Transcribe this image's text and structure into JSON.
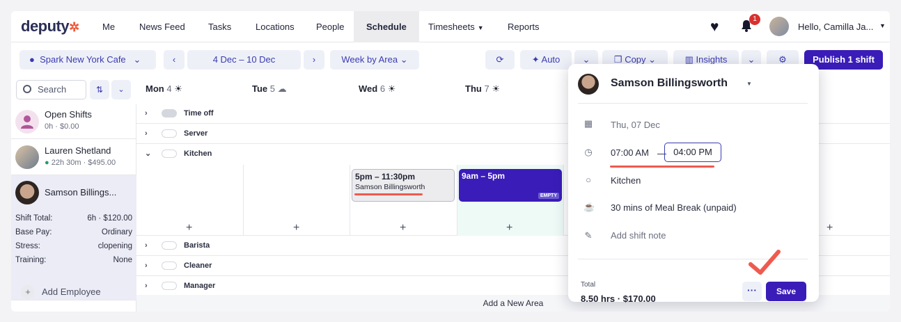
{
  "nav": {
    "logo": "deputy",
    "items": [
      "Me",
      "News Feed",
      "Tasks",
      "Locations",
      "People",
      "Schedule",
      "Timesheets",
      "Reports"
    ],
    "notification_count": "1",
    "user": "Hello, Camilla Ja..."
  },
  "toolbar": {
    "location": "Spark New York Cafe",
    "date_range": "4 Dec – 10 Dec",
    "view": "Week by Area",
    "auto": "Auto",
    "copy": "Copy",
    "insights": "Insights",
    "publish": "Publish 1 shift"
  },
  "sidebar": {
    "search_placeholder": "Search",
    "employees": [
      {
        "name": "Open Shifts",
        "sub": "0h · $0.00"
      },
      {
        "name": "Lauren Shetland",
        "sub": "22h 30m · $495.00"
      },
      {
        "name": "Samson Billings..."
      }
    ],
    "details": [
      {
        "k": "Shift Total:",
        "v": "6h  ·  $120.00"
      },
      {
        "k": "Base Pay:",
        "v": "Ordinary"
      },
      {
        "k": "Stress:",
        "v": "clopening"
      },
      {
        "k": "Training:",
        "v": "None"
      }
    ],
    "add_employee": "Add Employee"
  },
  "days": [
    {
      "name": "Mon",
      "num": "4"
    },
    {
      "name": "Tue",
      "num": "5"
    },
    {
      "name": "Wed",
      "num": "6"
    },
    {
      "name": "Thu",
      "num": "7"
    }
  ],
  "areas": [
    "Time off",
    "Server",
    "Kitchen",
    "Barista",
    "Cleaner",
    "Manager"
  ],
  "shifts": {
    "pending": {
      "time": "5pm – 11:30pm",
      "employee": "Samson Billingsworth"
    },
    "empty": {
      "time": "9am – 5pm",
      "tag": "EMPTY"
    }
  },
  "add_area": "Add a New Area",
  "popover": {
    "name": "Samson Billingsworth",
    "date": "Thu, 07 Dec",
    "start": "07:00 AM",
    "end": "04:00 PM",
    "area": "Kitchen",
    "break": "30 mins of Meal Break (unpaid)",
    "note_placeholder": "Add shift note",
    "total_label": "Total",
    "total": "8.50 hrs · $170.00",
    "more": "···",
    "save": "Save"
  },
  "colors": {
    "brand": "#3a1cb8",
    "accent_red": "#ef5a4f",
    "logo_star": "#ef5a3c"
  }
}
